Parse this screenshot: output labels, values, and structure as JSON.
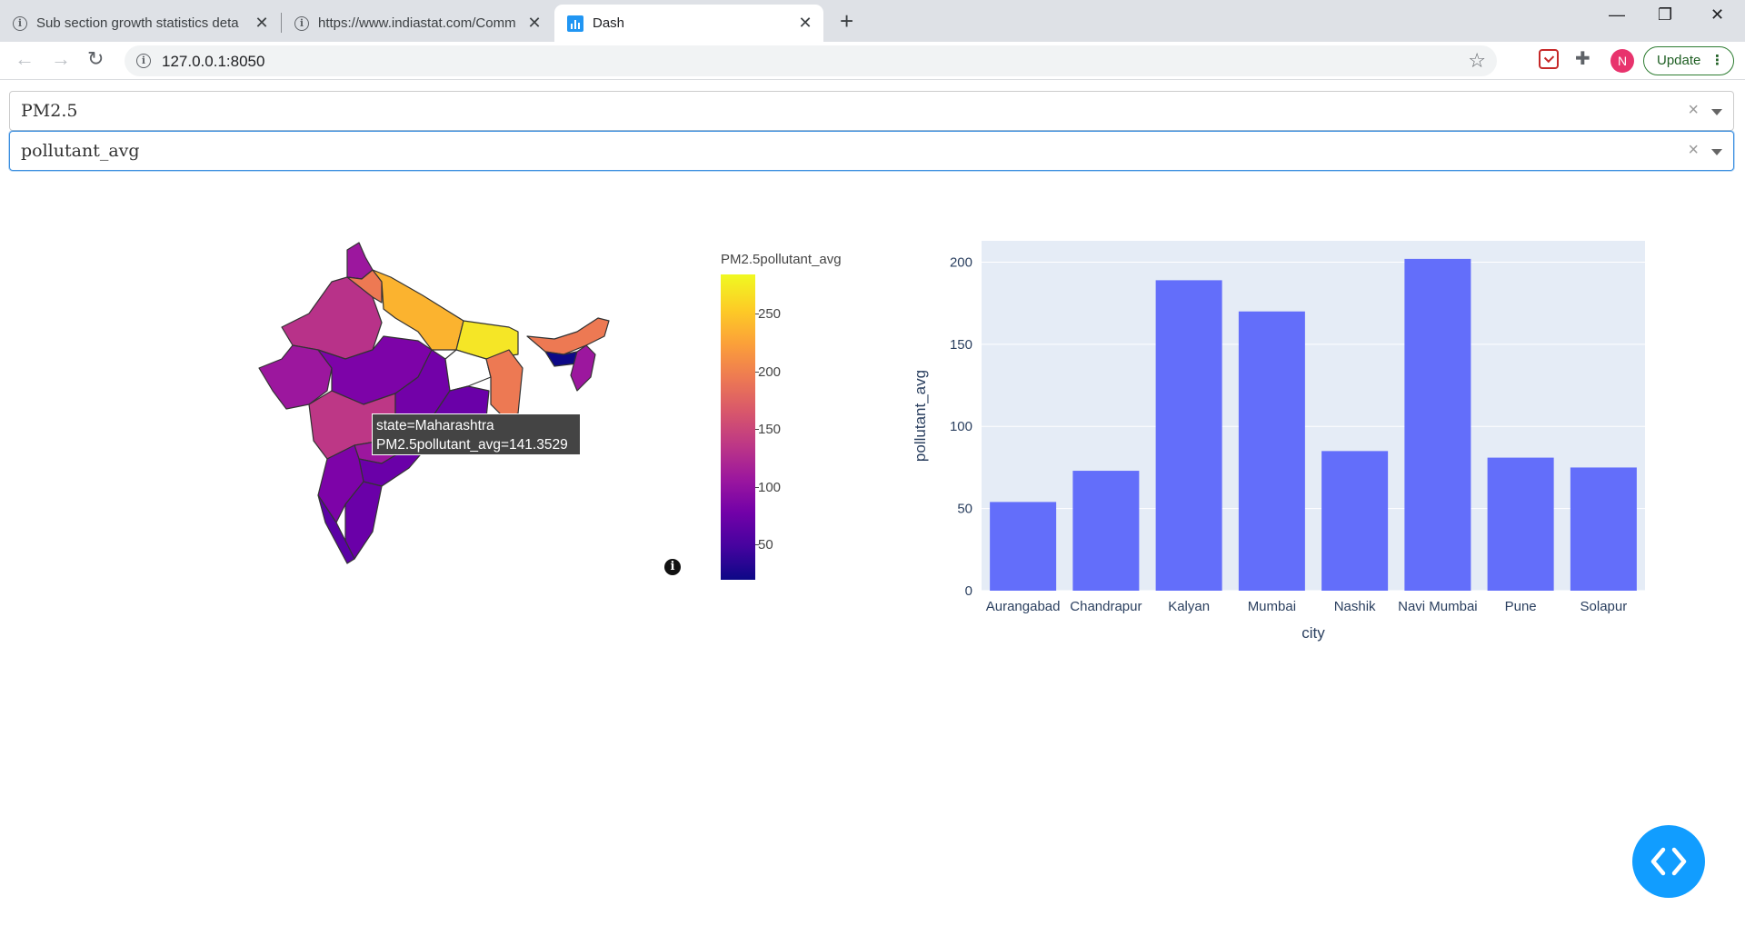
{
  "browser": {
    "tabs": [
      {
        "title": "Sub section growth statistics deta",
        "icon": "info-icon"
      },
      {
        "title": "https://www.indiastat.com/Comm",
        "icon": "info-icon"
      },
      {
        "title": "Dash",
        "icon": "dash-favicon",
        "active": true
      }
    ],
    "url": "127.0.0.1:8050",
    "avatar_letter": "N",
    "update_label": "Update"
  },
  "controls": {
    "pollutant_value": "PM2.5",
    "metric_value": "pollutant_avg"
  },
  "map": {
    "colorbar_title": "PM2.5pollutant_avg",
    "colorbar_range": [
      20,
      285
    ],
    "colorbar_ticks": [
      "250",
      "200",
      "150",
      "100",
      "50"
    ],
    "colorscale": "plasma",
    "tooltip_line1": "state=Maharashtra",
    "tooltip_line2": "PM2.5pollutant_avg=141.3529"
  },
  "chart_data": {
    "type": "bar",
    "categories": [
      "Aurangabad",
      "Chandrapur",
      "Kalyan",
      "Mumbai",
      "Nashik",
      "Navi Mumbai",
      "Pune",
      "Solapur"
    ],
    "values": [
      54,
      73,
      189,
      170,
      85,
      202,
      81,
      75
    ],
    "xlabel": "city",
    "ylabel": "pollutant_avg",
    "ylim": [
      0,
      213
    ],
    "yticks": [
      0,
      50,
      100,
      150,
      200
    ],
    "bar_color": "#636efa",
    "plot_bg": "#e5ecf6",
    "grid": true
  }
}
